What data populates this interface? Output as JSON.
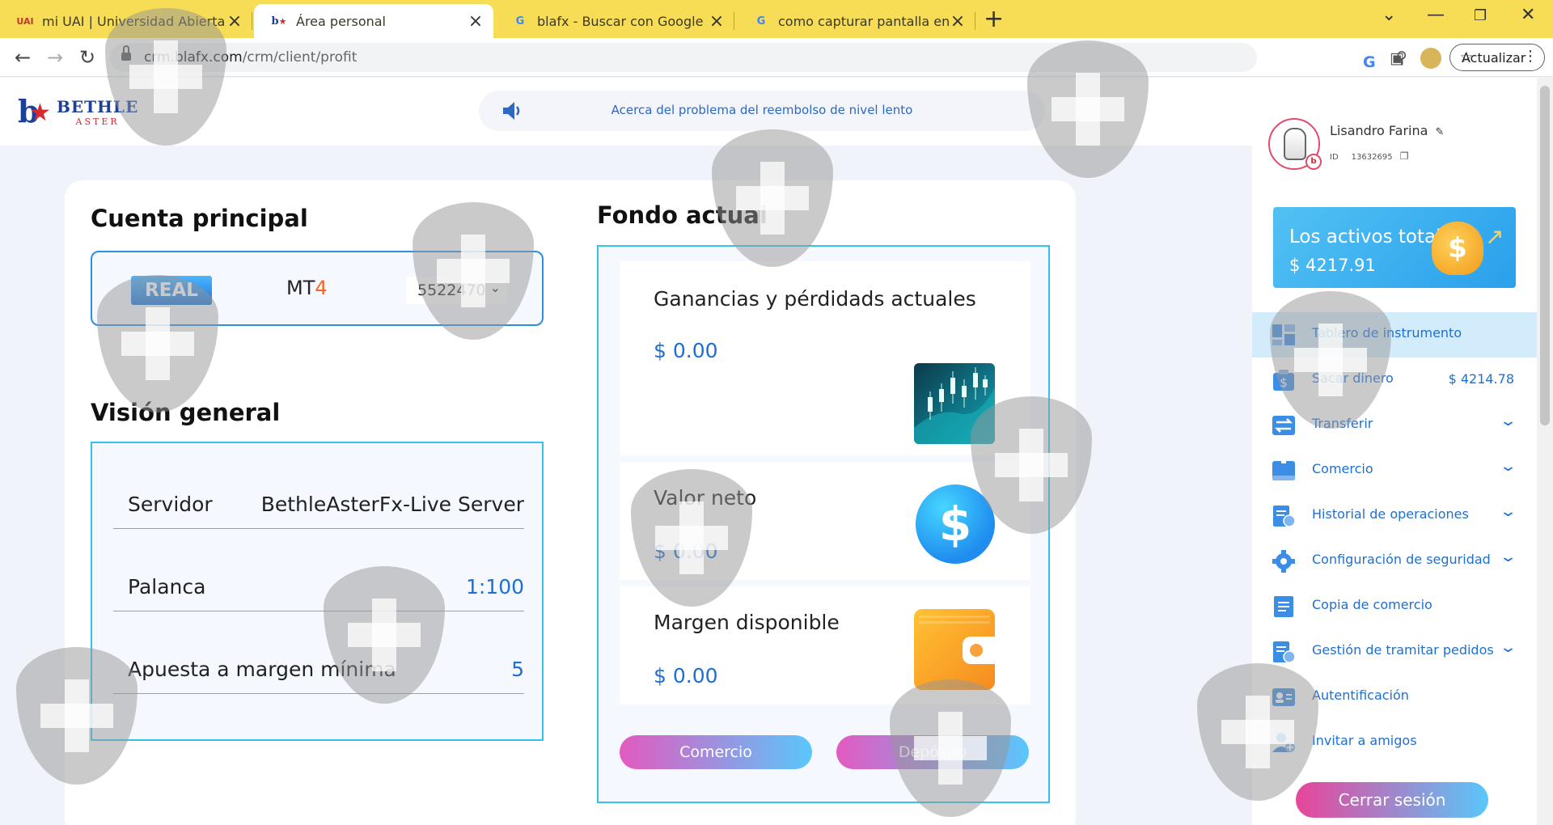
{
  "browser": {
    "tabs": [
      {
        "favicon": "UAI",
        "title": "mi UAI | Universidad Abierta Inte",
        "active": false
      },
      {
        "favicon": "bethle-logo-icon",
        "title": "Área personal",
        "active": true
      },
      {
        "favicon": "google-icon",
        "title": "blafx - Buscar con Google",
        "active": false
      },
      {
        "favicon": "google-icon",
        "title": "como capturar pantalla en la pc",
        "active": false
      }
    ],
    "url_host": "crm.blafx.com",
    "url_path": "/crm/client/profit",
    "update_label": "Actualizar"
  },
  "header": {
    "logo_main": "BETHLE",
    "logo_sub": "ASTER",
    "notice": "Acerca del problema del reembolso de nivel lento",
    "language_flag": "es"
  },
  "main_account": {
    "title": "Cuenta principal",
    "badge": "REAL",
    "platform_prefix": "MT",
    "platform_suffix": "4",
    "account_number": "5522470"
  },
  "overview": {
    "title": "Visión general",
    "rows": [
      {
        "key": "Servidor",
        "value": "BethleAsterFx-Live Server"
      },
      {
        "key": "Palanca",
        "value": "1:100"
      },
      {
        "key": "Apuesta a margen mínima",
        "value": "5"
      }
    ]
  },
  "funds": {
    "title": "Fondo actual",
    "cards": [
      {
        "label": "Ganancias y pérdidads actuales",
        "value": "$ 0.00",
        "icon": "candlestick-chart-icon"
      },
      {
        "label": "Valor neto",
        "value": "$ 0.00",
        "icon": "dollar-coin-icon"
      },
      {
        "label": "Margen disponible",
        "value": "$ 0.00",
        "icon": "wallet-icon"
      }
    ],
    "buttons": {
      "trade": "Comercio",
      "deposit": "Depósito"
    }
  },
  "sidebar": {
    "user_name": "Lisandro Farina",
    "id_label": "ID",
    "id_value": "13632695",
    "assets_title": "Los activos totales",
    "assets_value": "$ 4217.91",
    "menu": [
      {
        "label": "Tablero de instrumento",
        "icon": "dashboard-icon",
        "active": true
      },
      {
        "label": "Sacar dinero",
        "icon": "withdraw-icon",
        "amount": "$ 4214.78"
      },
      {
        "label": "Transferir",
        "icon": "transfer-icon",
        "expandable": true
      },
      {
        "label": "Comercio",
        "icon": "trade-icon",
        "expandable": true
      },
      {
        "label": "Historial de operaciones",
        "icon": "history-icon",
        "expandable": true
      },
      {
        "label": "Configuración de seguridad",
        "icon": "gear-icon",
        "expandable": true
      },
      {
        "label": "Copia de comercio",
        "icon": "copy-trade-icon"
      },
      {
        "label": "Gestión de tramitar pedidos",
        "icon": "orders-icon",
        "expandable": true
      },
      {
        "label": "Autentificación",
        "icon": "id-card-icon"
      },
      {
        "label": "Invitar a amigos",
        "icon": "invite-user-icon"
      }
    ],
    "logout": "Cerrar sesión"
  },
  "colors": {
    "tabstrip": "#f7dc55",
    "accent_blue": "#1f6fd0",
    "border_cyan": "#33c3e8",
    "gradient_pink": "#e35ac0",
    "gradient_cyan": "#59c7fb"
  }
}
